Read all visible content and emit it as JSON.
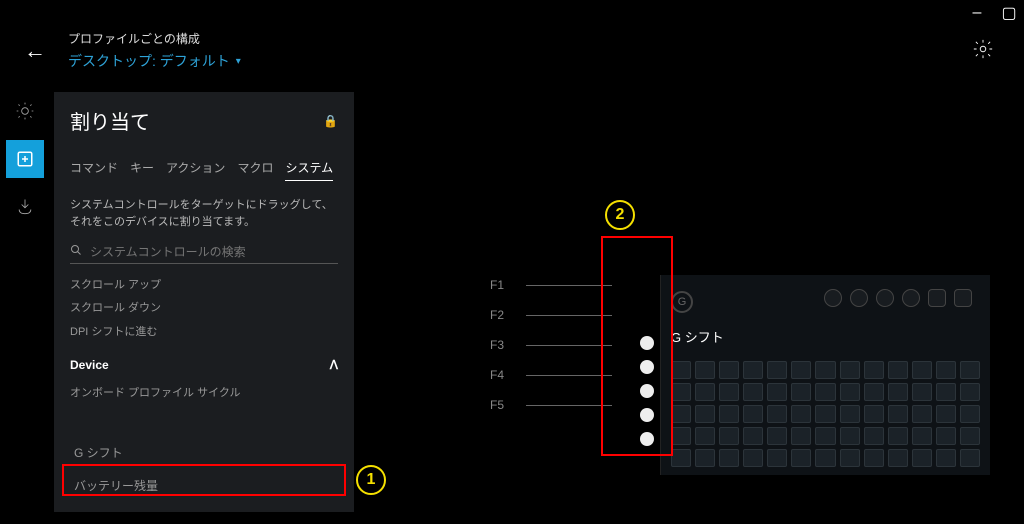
{
  "window": {
    "minimize": "–",
    "maximize": "▢"
  },
  "header": {
    "line1": "プロファイルごとの構成",
    "line2": "デスクトップ: デフォルト"
  },
  "panel": {
    "title": "割り当て",
    "tabs": [
      "コマンド",
      "キー",
      "アクション",
      "マクロ",
      "システム"
    ],
    "active_tab": 4,
    "hint": "システムコントロールをターゲットにドラッグして、それをこのデバイスに割り当てます。",
    "search_placeholder": "システムコントロールの検索",
    "items": [
      "スクロール アップ",
      "スクロール ダウン",
      "DPI シフトに進む"
    ],
    "device_section": "Device",
    "device_items": [
      "オンボード プロファイル サイクル",
      "G シフト",
      "バッテリー残量"
    ]
  },
  "keyboard": {
    "f_labels": [
      "F1",
      "F2",
      "F3",
      "F4",
      "F5"
    ],
    "gshift_label": "G シフト",
    "logo": "G"
  },
  "annotations": {
    "badge1": "1",
    "badge2": "2"
  }
}
